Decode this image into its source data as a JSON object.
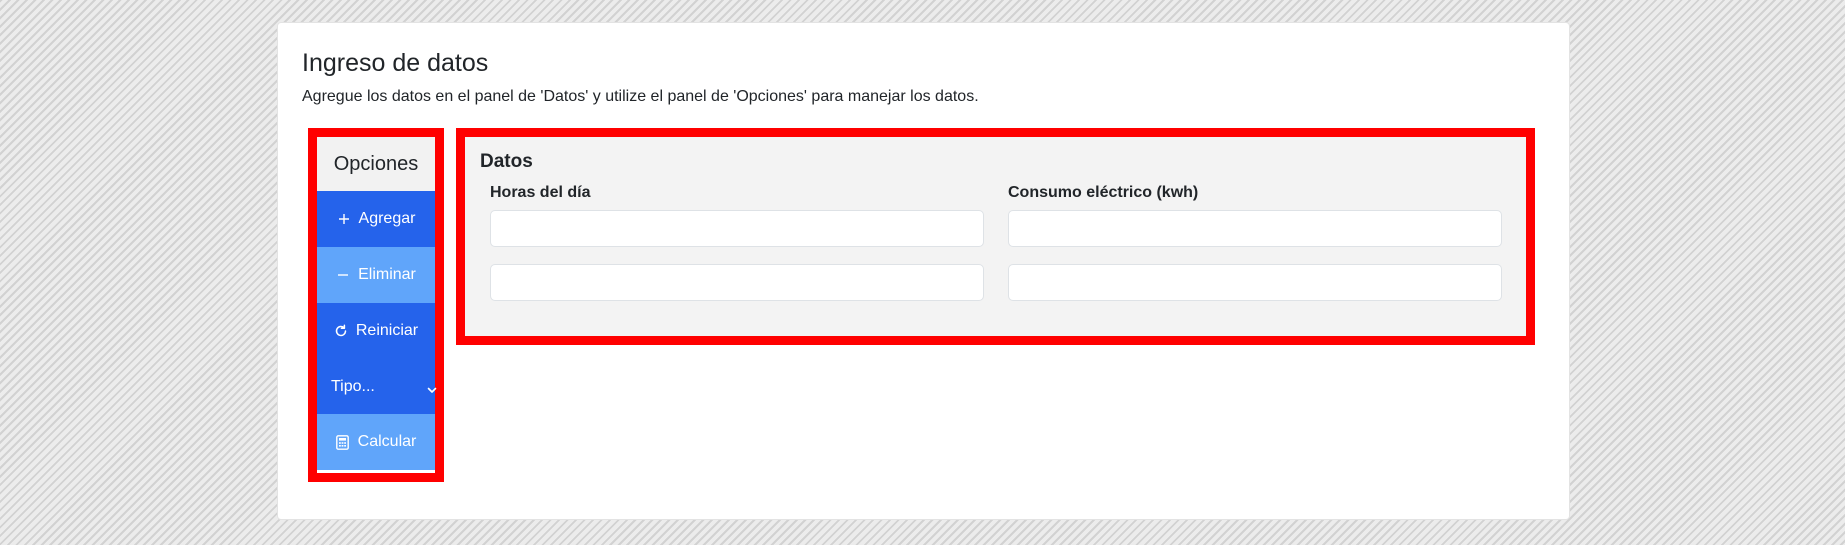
{
  "page": {
    "title": "Ingreso de datos",
    "subtitle": "Agregue los datos en el panel de 'Datos' y utilize el panel de 'Opciones' para manejar los datos."
  },
  "options": {
    "header": "Opciones",
    "buttons": {
      "add": {
        "label": "Agregar",
        "icon": "plus-icon",
        "color": "#2563eb"
      },
      "remove": {
        "label": "Eliminar",
        "icon": "minus-icon",
        "color": "#60a5fa"
      },
      "reset": {
        "label": "Reiniciar",
        "icon": "refresh-icon",
        "color": "#2563eb"
      },
      "calculate": {
        "label": "Calcular",
        "icon": "calculator-icon",
        "color": "#60a5fa"
      }
    },
    "type_select": {
      "value": "Tipo...",
      "icon": "chevron-down-icon"
    }
  },
  "data_panel": {
    "title": "Datos",
    "columns": [
      "Horas del día",
      "Consumo eléctrico (kwh)"
    ],
    "rows": [
      {
        "hours": "",
        "consumption": ""
      },
      {
        "hours": "",
        "consumption": ""
      }
    ]
  },
  "colors": {
    "highlight_border": "#ff0000",
    "primary_button": "#2563eb",
    "light_button": "#60a5fa",
    "panel_background": "#f3f3f3"
  }
}
